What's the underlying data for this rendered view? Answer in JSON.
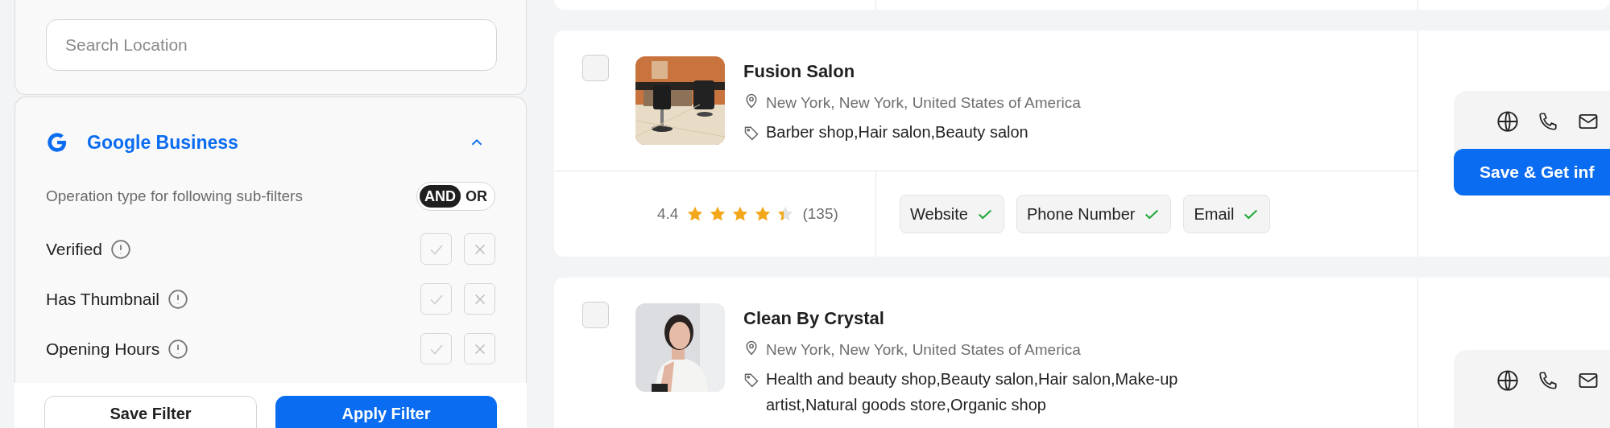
{
  "sidebar": {
    "search": {
      "placeholder": "Search Location"
    },
    "google_business": {
      "title": "Google Business",
      "expanded": true,
      "operation_label": "Operation type for following sub-filters",
      "operation_options": [
        {
          "label": "AND",
          "selected": true
        },
        {
          "label": "OR",
          "selected": false
        }
      ],
      "filters": [
        {
          "label": "Verified"
        },
        {
          "label": "Has Thumbnail"
        },
        {
          "label": "Opening Hours"
        }
      ]
    },
    "buttons": [
      {
        "label": "Save Filter",
        "kind": "secondary"
      },
      {
        "label": "Apply Filter",
        "kind": "primary"
      }
    ]
  },
  "results": [
    {
      "name": "Fusion Salon",
      "location": "New York, New York, United States of America",
      "categories": "Barber shop,Hair salon,Beauty salon",
      "rating": "4.4",
      "stars": 4.4,
      "reviews": "(135)",
      "contacts": [
        {
          "label": "Website",
          "available": true
        },
        {
          "label": "Phone Number",
          "available": true
        },
        {
          "label": "Email",
          "available": true
        }
      ],
      "action": "Save & Get inf",
      "checked": false
    },
    {
      "name": "Clean By Crystal",
      "location": "New York, New York, United States of America",
      "categories": "Health and beauty shop,Beauty salon,Hair salon,Make-up artist,Natural goods store,Organic shop",
      "checked": false
    }
  ]
}
